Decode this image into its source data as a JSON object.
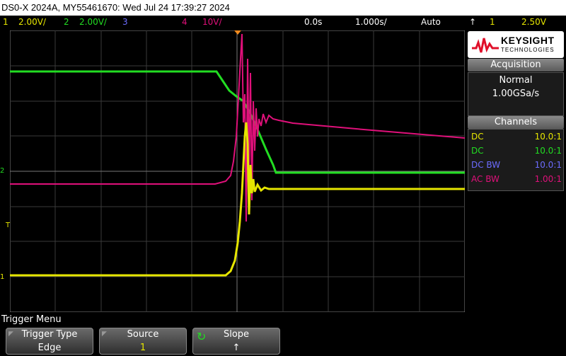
{
  "title": "DS0-X 2024A, MY55461670: Wed Jul 24 17:39:27 2024",
  "colors": {
    "ch1": "#e6e600",
    "ch2": "#22dd22",
    "ch3": "#6c6cff",
    "ch4": "#e0107a"
  },
  "status": {
    "ch1_num": "1",
    "ch1_scale": "2.00V/",
    "ch2_num": "2",
    "ch2_scale": "2.00V/",
    "ch3_num": "3",
    "ch4_num": "4",
    "ch4_scale": "10V/",
    "time_delay": "0.0s",
    "time_scale": "1.000s/",
    "run_mode": "Auto",
    "trigger_slope_icon": "rising-edge-icon",
    "trigger_source": "1",
    "trigger_level": "2.50V"
  },
  "markers": {
    "ch1": "1",
    "ch2": "2",
    "trigger": "T"
  },
  "logo": {
    "line1": "KEYSIGHT",
    "line2": "TECHNOLOGIES"
  },
  "acquisition": {
    "header": "Acquisition",
    "mode": "Normal",
    "rate": "1.00GSa/s"
  },
  "channels": {
    "header": "Channels",
    "rows": [
      {
        "coupling": "DC",
        "probe": "10.0:1"
      },
      {
        "coupling": "DC",
        "probe": "10.0:1"
      },
      {
        "coupling": "DC BW",
        "probe": "10.0:1"
      },
      {
        "coupling": "AC BW",
        "probe": "1.00:1"
      }
    ]
  },
  "menu": {
    "title": "Trigger Menu",
    "softkeys": [
      {
        "label": "Trigger Type",
        "value": "Edge"
      },
      {
        "label": "Source",
        "value": "1"
      },
      {
        "label": "Slope",
        "value": "↑"
      }
    ]
  }
}
